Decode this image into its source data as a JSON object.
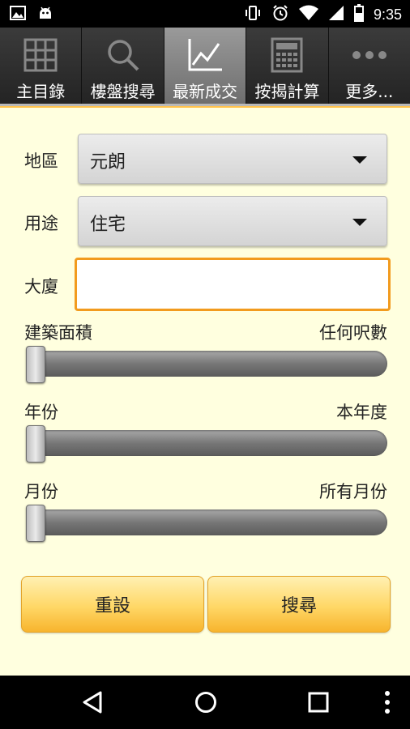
{
  "status_bar": {
    "time": "9:35",
    "left_icons": [
      "image-icon",
      "android-icon"
    ],
    "right_icons": [
      "vibrate-icon",
      "alarm-icon",
      "wifi-icon",
      "signal-icon",
      "battery-icon"
    ]
  },
  "tabs": [
    {
      "label": "主目錄",
      "icon": "grid-icon",
      "active": false
    },
    {
      "label": "樓盤搜尋",
      "icon": "search-icon",
      "active": false
    },
    {
      "label": "最新成交",
      "icon": "line-chart-icon",
      "active": true
    },
    {
      "label": "按揭計算",
      "icon": "calculator-icon",
      "active": false
    },
    {
      "label": "更多...",
      "icon": "more-icon",
      "active": false
    }
  ],
  "form": {
    "district": {
      "label": "地區",
      "value": "元朗"
    },
    "usage": {
      "label": "用途",
      "value": "住宅"
    },
    "building": {
      "label": "大廈",
      "value": "",
      "placeholder": ""
    },
    "area_slider": {
      "label": "建築面積",
      "value_text": "任何呎數",
      "position": 0
    },
    "year_slider": {
      "label": "年份",
      "value_text": "本年度",
      "position": 0
    },
    "month_slider": {
      "label": "月份",
      "value_text": "所有月份",
      "position": 0
    }
  },
  "buttons": {
    "reset": "重設",
    "search": "搜尋"
  },
  "colors": {
    "form_bg": "#ffffdf",
    "accent": "#f29b1e",
    "button": "#ffd766"
  }
}
